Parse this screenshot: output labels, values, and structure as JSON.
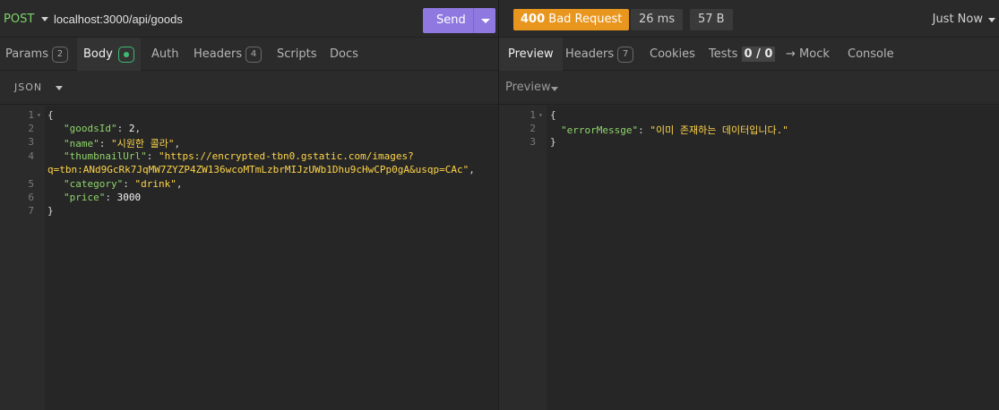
{
  "request": {
    "method": "POST",
    "url": "localhost:3000/api/goods",
    "send_label": "Send"
  },
  "response_meta": {
    "status_code": "400",
    "status_text": "Bad Request",
    "time": "26 ms",
    "size": "57 B",
    "timestamp": "Just Now"
  },
  "request_tabs": [
    {
      "label": "Params",
      "count": "2"
    },
    {
      "label": "Body"
    },
    {
      "label": "Auth"
    },
    {
      "label": "Headers",
      "count": "4"
    },
    {
      "label": "Scripts"
    },
    {
      "label": "Docs"
    }
  ],
  "response_tabs": [
    {
      "label": "Preview"
    },
    {
      "label": "Headers",
      "count": "7"
    },
    {
      "label": "Cookies"
    },
    {
      "label": "Tests",
      "score": "0 / 0"
    },
    {
      "label": "→ Mock"
    },
    {
      "label": "Console"
    }
  ],
  "body_format": "JSON",
  "preview_label": "Preview",
  "request_body": {
    "line_numbers": [
      "1",
      "2",
      "3",
      "4",
      "5",
      "6",
      "7"
    ],
    "open_brace": "{",
    "close_brace": "}",
    "goodsId_key": "\"goodsId\"",
    "goodsId_val": "2",
    "name_key": "\"name\"",
    "name_val": "\"시원한 콜라\"",
    "thumb_key": "\"thumbnailUrl\"",
    "thumb_val_1": "\"https://encrypted-tbn0.gstatic.com/images?",
    "thumb_val_2": "q=tbn:ANd9GcRk7JqMW7ZYZP4ZW136wcoMTmLzbrMIJzUWb1Dhu9cHwCPp0gA&usqp=CAc\"",
    "category_key": "\"category\"",
    "category_val": "\"drink\"",
    "price_key": "\"price\"",
    "price_val": "3000"
  },
  "response_body": {
    "line_numbers": [
      "1",
      "2",
      "3"
    ],
    "open_brace": "{",
    "close_brace": "}",
    "error_key": "\"errorMessge\"",
    "error_val": "\"이미 존재하는 데이터입니다.\""
  },
  "colors": {
    "method": "#7cd36a",
    "send_button": "#8f79e0",
    "status_badge": "#e8961e",
    "json_key": "#8fd46a",
    "json_string": "#ffd54a"
  }
}
